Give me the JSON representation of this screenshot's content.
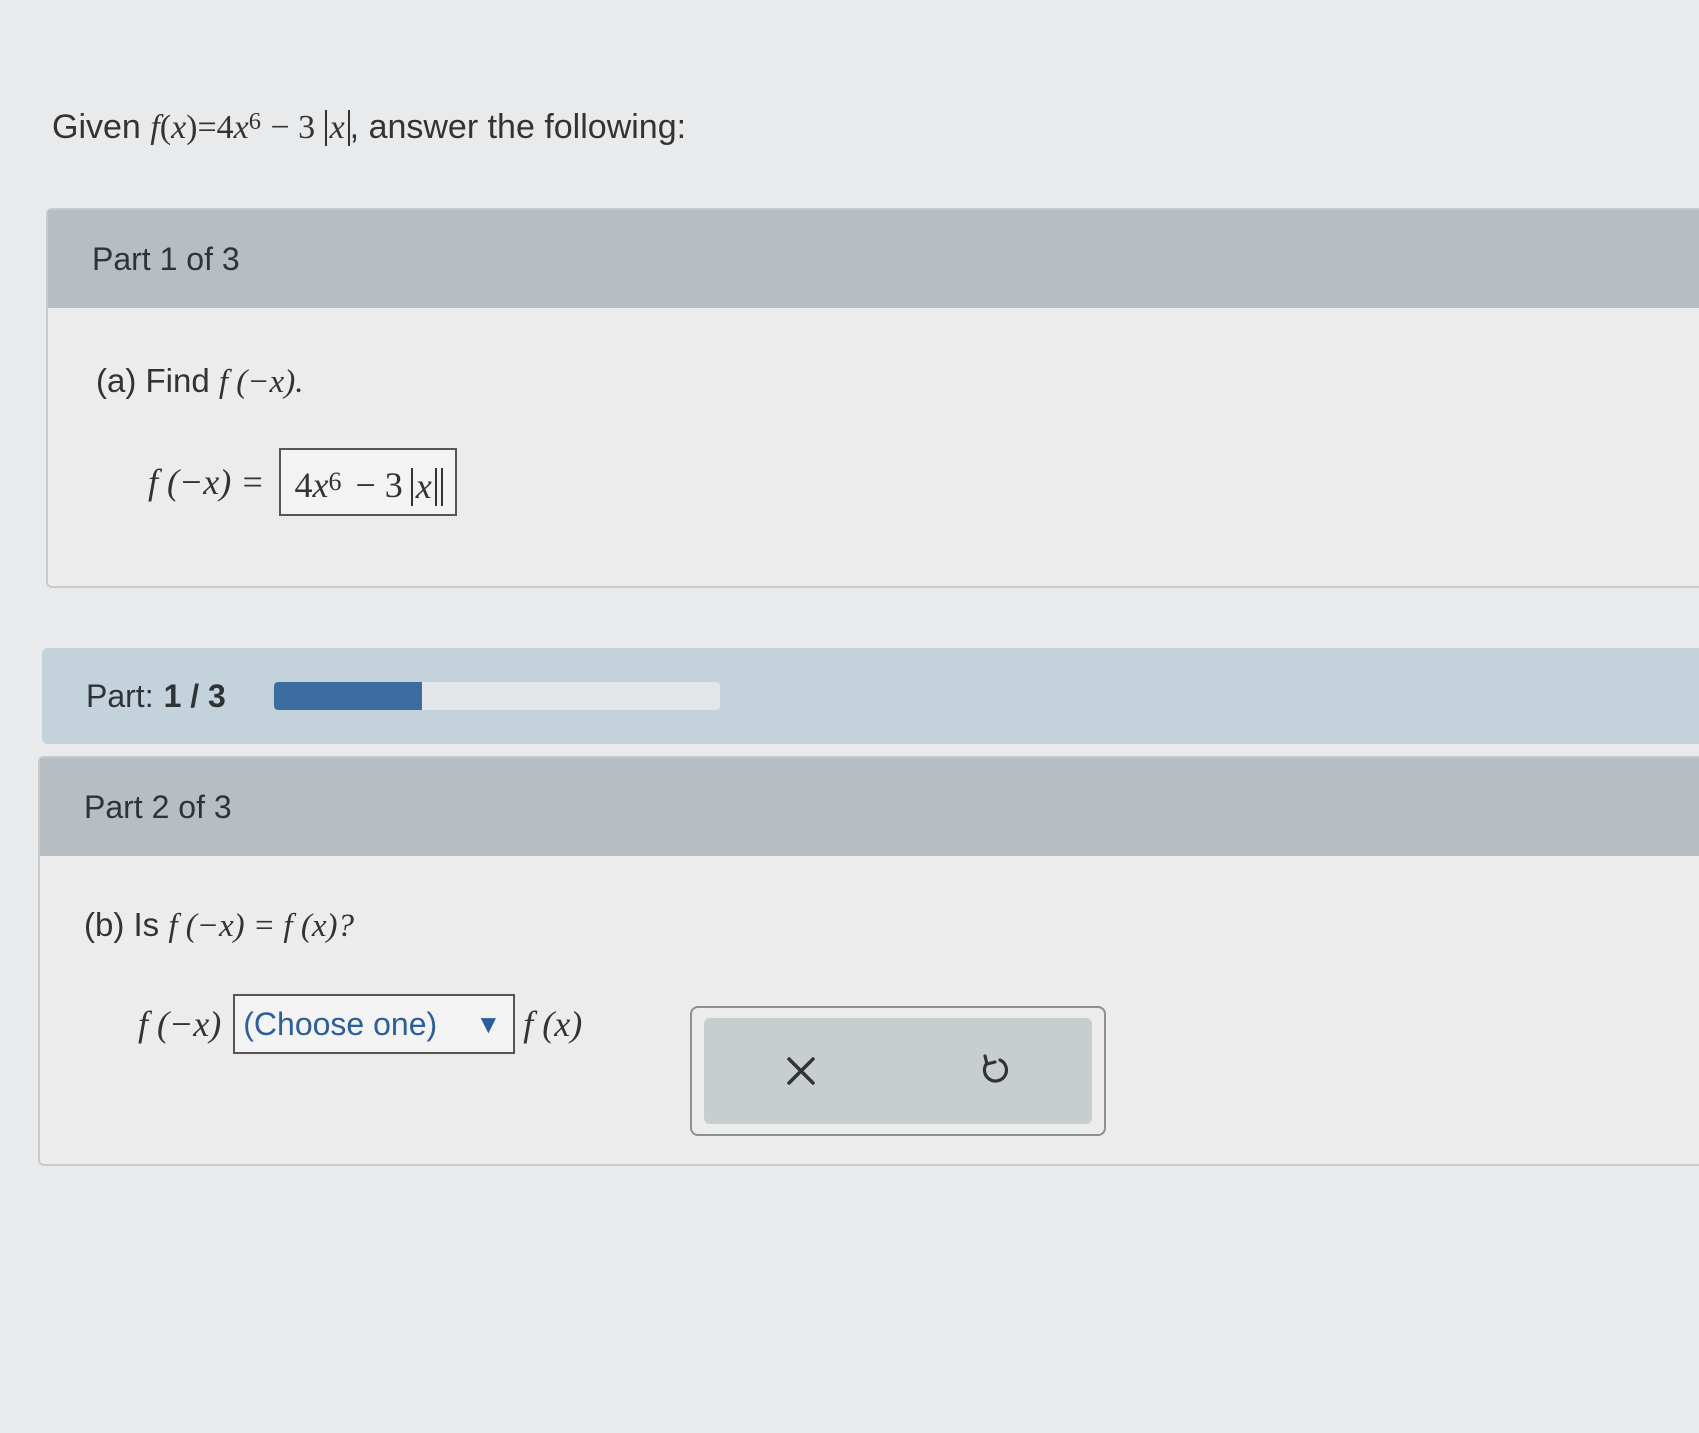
{
  "question": {
    "prefix": "Given",
    "fname": "f",
    "arg": "x",
    "coef": "4",
    "var": "x",
    "exponent": "6",
    "op": "− 3",
    "abs_var": "x",
    "suffix": ", answer the following:"
  },
  "part1": {
    "header": "Part 1 of 3",
    "prompt_label": "(a) Find",
    "prompt_expr": "f (−x).",
    "answer_lhs": "f (−x) =",
    "answer": {
      "coef": "4",
      "var": "x",
      "exponent": "6",
      "op": "− 3",
      "abs_var": "x"
    }
  },
  "progress": {
    "label": "Part:",
    "value_text": "1 / 3",
    "fraction": 0.333
  },
  "part2": {
    "header": "Part 2 of 3",
    "prompt_label": "(b) Is",
    "prompt_expr": "f (−x) = f (x)?",
    "lhs": "f (−x)",
    "select_value": "(Choose one)",
    "rhs": "f (x)"
  },
  "tools": {
    "clear_icon": "close-icon",
    "undo_icon": "undo-icon"
  }
}
